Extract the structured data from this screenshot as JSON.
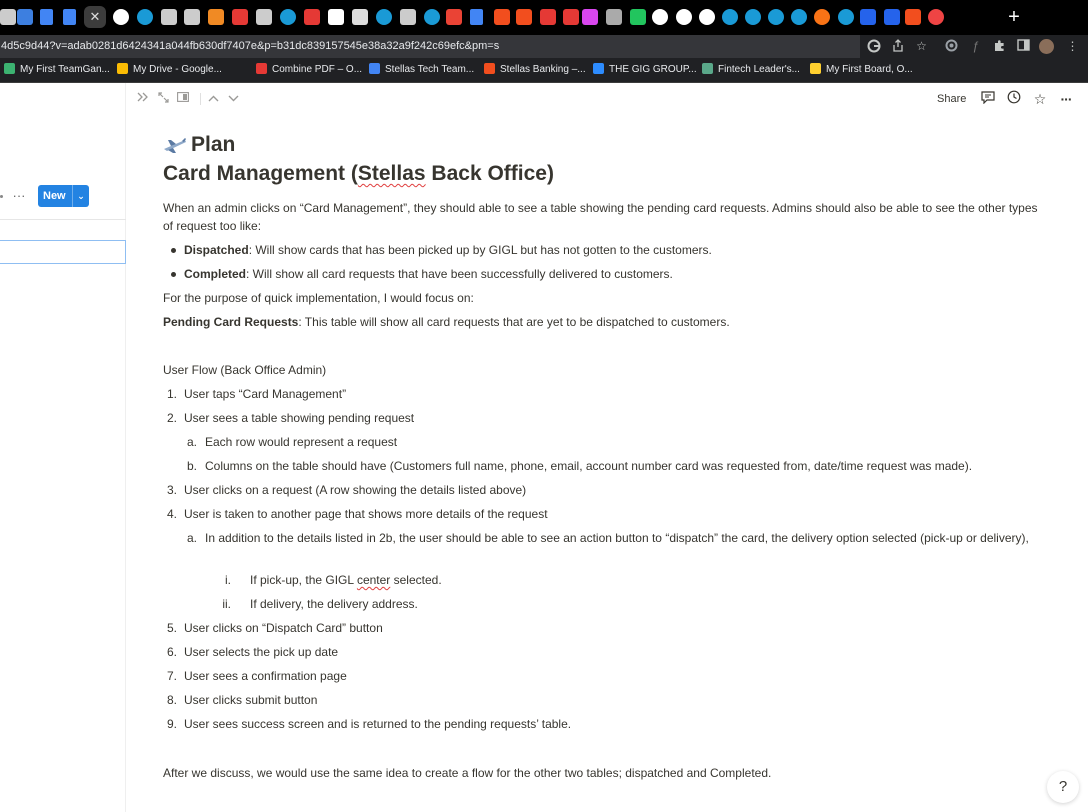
{
  "browser": {
    "url": "4d5c9d44?v=adab0281d6424341a044fb630df7407e&p=b31dc839157545e38a32a9f242c69efc&pm=s",
    "active_tab_close_glyph": "✕",
    "new_tab_glyph": "+",
    "tab_icons": [
      {
        "icon": "notion-icon",
        "color": "#cccccc"
      },
      {
        "icon": "play-arrow-icon",
        "color": "#3d7fe0"
      },
      {
        "icon": "google-docs-icon",
        "color": "#4285f4"
      },
      {
        "icon": "google-docs-icon",
        "color": "#4285f4"
      },
      {
        "icon": "google-icon",
        "color": "#ffffff"
      },
      {
        "icon": "circle-blue-icon",
        "color": "#1a9ad6"
      },
      {
        "icon": "plane-icon",
        "color": "#cccccc"
      },
      {
        "icon": "tn-icon",
        "color": "#cccccc"
      },
      {
        "icon": "orange-dollar-icon",
        "color": "#f08a24"
      },
      {
        "icon": "v-icon",
        "color": "#e53935"
      },
      {
        "icon": "snowflake-icon",
        "color": "#cccccc"
      },
      {
        "icon": "circle-blue-icon",
        "color": "#1a9ad6"
      },
      {
        "icon": "red-square-icon",
        "color": "#e53935"
      },
      {
        "icon": "white-square-icon",
        "color": "#ffffff"
      },
      {
        "icon": "github-icon",
        "color": "#dddddd"
      },
      {
        "icon": "circle-blue-icon",
        "color": "#1a9ad6"
      },
      {
        "icon": "tn-icon",
        "color": "#cccccc"
      },
      {
        "icon": "circle-blue-icon",
        "color": "#1a9ad6"
      },
      {
        "icon": "red-g-icon",
        "color": "#ea4335"
      },
      {
        "icon": "google-docs-icon",
        "color": "#4285f4"
      },
      {
        "icon": "figma-icon",
        "color": "#f24e1e"
      },
      {
        "icon": "figma-icon",
        "color": "#f24e1e"
      },
      {
        "icon": "loop-red-icon",
        "color": "#e53935"
      },
      {
        "icon": "loop-red-icon",
        "color": "#e53935"
      },
      {
        "icon": "multicolor-icon",
        "color": "#d946ef"
      },
      {
        "icon": "g-box-icon",
        "color": "#aaaaaa"
      },
      {
        "icon": "green-chart-icon",
        "color": "#22c55e"
      },
      {
        "icon": "google-icon",
        "color": "#ffffff"
      },
      {
        "icon": "google-icon",
        "color": "#ffffff"
      },
      {
        "icon": "google-icon",
        "color": "#ffffff"
      },
      {
        "icon": "circle-blue-icon",
        "color": "#1a9ad6"
      },
      {
        "icon": "circle-blue-icon",
        "color": "#1a9ad6"
      },
      {
        "icon": "circle-blue-icon",
        "color": "#1a9ad6"
      },
      {
        "icon": "circle-blue-icon",
        "color": "#1a9ad6"
      },
      {
        "icon": "orange-gear-icon",
        "color": "#f97316"
      },
      {
        "icon": "circle-blue-icon",
        "color": "#1a9ad6"
      },
      {
        "icon": "blue-badge-icon",
        "color": "#2563eb"
      },
      {
        "icon": "blue-badge-icon",
        "color": "#2563eb"
      },
      {
        "icon": "figma-icon",
        "color": "#f24e1e"
      },
      {
        "icon": "red-dot-icon",
        "color": "#ef4444"
      }
    ],
    "bookmarks": [
      {
        "label": "My First TeamGan...",
        "icon": "teamgantt-icon",
        "color": "#3cb371"
      },
      {
        "label": "My Drive - Google...",
        "icon": "google-drive-icon",
        "color": "#fbbc04"
      },
      {
        "label": "Combine PDF – O...",
        "icon": "pdf-icon",
        "color": "#e53935"
      },
      {
        "label": "Stellas Tech Team...",
        "icon": "google-docs-icon",
        "color": "#4285f4"
      },
      {
        "label": "Stellas Banking –...",
        "icon": "figma-icon",
        "color": "#f24e1e"
      },
      {
        "label": "THE GIG GROUP...",
        "icon": "video-icon",
        "color": "#2d8cff"
      },
      {
        "label": "Fintech Leader's...",
        "icon": "fintech-icon",
        "color": "#5aa88a"
      },
      {
        "label": "My First Board, O...",
        "icon": "miro-icon",
        "color": "#ffd02f"
      }
    ]
  },
  "sidebar": {
    "more_glyph": "···",
    "new_button": "New",
    "new_chevron": "⌄"
  },
  "topbar": {
    "share": "Share"
  },
  "page": {
    "title_prefix": "Plan",
    "title_main_before": "Card Management (",
    "title_main_underlined": "Stellas",
    "title_main_after": " Back Office)",
    "intro": "When an admin clicks on “Card Management”, they should able to see a table showing the pending card requests. Admins should also be able to see the other types of request too like:",
    "bullets": [
      {
        "bold": "Dispatched",
        "text": ": Will show cards that has been picked up by GIGL but has not gotten to the customers."
      },
      {
        "bold": "Completed",
        "text": ": Will show all card requests that have been successfully delivered to customers."
      }
    ],
    "focus": "For the purpose of quick implementation, I would focus on:",
    "pending_bold": "Pending Card Requests",
    "pending_text": ": This table will show all card requests that are yet to be dispatched to customers.",
    "flow_heading": "User Flow (Back Office Admin)",
    "steps": [
      {
        "marker": "1.",
        "text": "User taps “Card Management”"
      },
      {
        "marker": "2.",
        "text": "User sees a table showing pending request"
      },
      {
        "marker": "a.",
        "text": "Each row would represent a request"
      },
      {
        "marker": "b.",
        "text": "Columns on the table should have (Customers full name, phone, email, account number card was requested from, date/time request was made)."
      },
      {
        "marker": "3.",
        "text": "User clicks on a request (A row showing the details listed above)"
      },
      {
        "marker": "4.",
        "text": "User is taken to another page that shows more details of the request"
      },
      {
        "marker": "a.",
        "text": "In addition to the details listed in 2b, the user should be able to see an action button to “dispatch” the card, the delivery option selected (pick-up or delivery),"
      },
      {
        "marker": "i.",
        "text_before": "If pick-up, the GIGL ",
        "text_underlined": "center",
        "text_after": " selected."
      },
      {
        "marker": "ii.",
        "text": "If delivery, the delivery address."
      },
      {
        "marker": "5.",
        "text": "User clicks on “Dispatch Card” button"
      },
      {
        "marker": "6.",
        "text": "User selects the pick up date"
      },
      {
        "marker": "7.",
        "text": "User sees a confirmation page"
      },
      {
        "marker": "8.",
        "text": "User clicks submit button"
      },
      {
        "marker": "9.",
        "text": "User sees success screen and is returned to the pending requests’ table."
      }
    ],
    "closing": "After we discuss, we would use the same idea to create a flow for the other two tables; dispatched and Completed."
  },
  "help": "?"
}
